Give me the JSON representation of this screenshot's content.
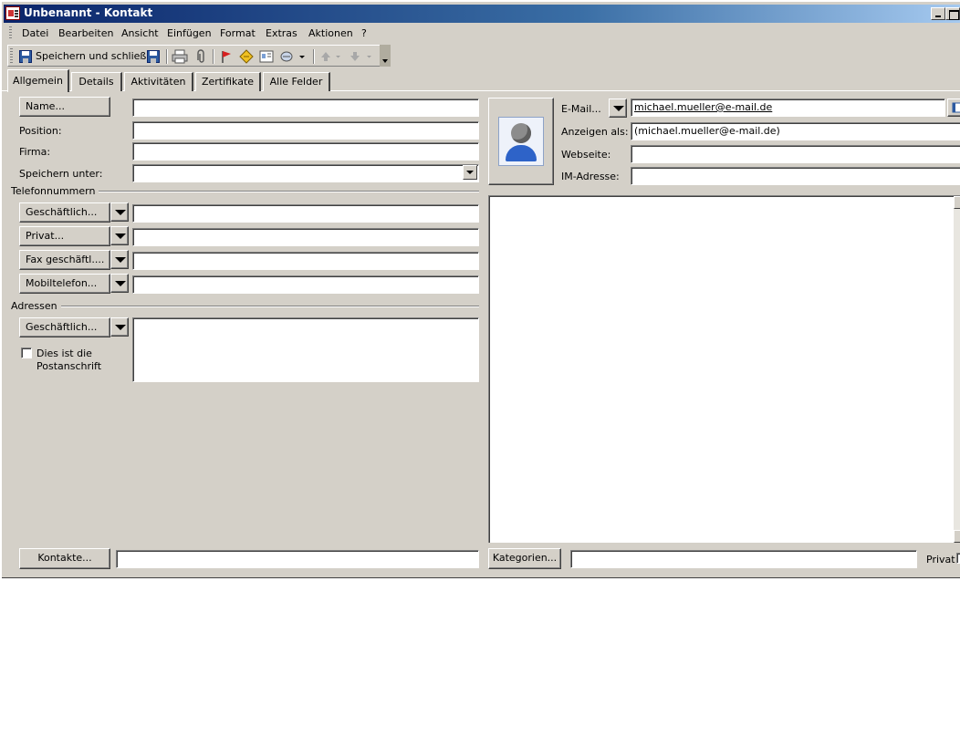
{
  "window": {
    "title": "Unbenannt - Kontakt"
  },
  "menu": [
    "Datei",
    "Bearbeiten",
    "Ansicht",
    "Einfügen",
    "Format",
    "Extras",
    "Aktionen",
    "?"
  ],
  "toolbar": {
    "save_close_label": "Speichern und schließen"
  },
  "tabs": [
    "Allgemein",
    "Details",
    "Aktivitäten",
    "Zertifikate",
    "Alle Felder"
  ],
  "general": {
    "name_button": "Name...",
    "position_label": "Position:",
    "company_label": "Firma:",
    "save_as_label": "Speichern unter:",
    "name_value": "",
    "position_value": "",
    "company_value": "",
    "save_as_value": ""
  },
  "phone": {
    "section_title": "Telefonnummern",
    "buttons": [
      "Geschäftlich...",
      "Privat...",
      "Fax geschäftl....",
      "Mobiltelefon..."
    ]
  },
  "address": {
    "section_title": "Adressen",
    "button": "Geschäftlich...",
    "postal_checkbox_label_1": "Dies ist die",
    "postal_checkbox_label_2": "Postanschrift",
    "postal_checked": false
  },
  "contact": {
    "email_button": "E-Mail...",
    "email_value": "michael.mueller@e-mail.de",
    "display_as_label": "Anzeigen als:",
    "display_as_value": "(michael.mueller@e-mail.de)",
    "website_label": "Webseite:",
    "im_label": "IM-Adresse:"
  },
  "footer": {
    "contacts_button": "Kontakte...",
    "categories_button": "Kategorien...",
    "private_label": "Privat"
  },
  "icons": [
    "save-icon",
    "print-icon",
    "paperclip-icon",
    "flag-icon",
    "address-card-icon",
    "new-item-icon",
    "up-arrow-icon",
    "down-arrow-icon"
  ]
}
